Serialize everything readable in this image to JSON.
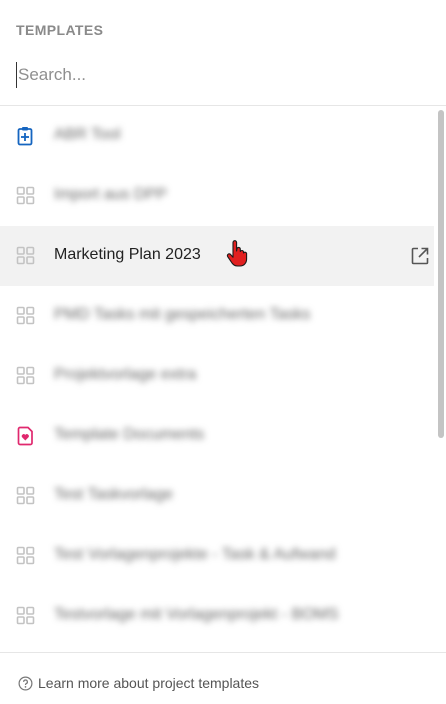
{
  "panel": {
    "section_title": "TEMPLATES",
    "search": {
      "placeholder": "Search...",
      "value": ""
    }
  },
  "templates": [
    {
      "label": "ABR Tool",
      "icon": "clipboard-plus-icon",
      "blurred": true
    },
    {
      "label": "Import aus DPP",
      "icon": "grid-icon",
      "blurred": true
    },
    {
      "label": "Marketing Plan 2023",
      "icon": "grid-icon",
      "blurred": false,
      "hovered": true
    },
    {
      "label": "PMD Tasks mit gespeicherten Tasks",
      "icon": "grid-icon",
      "blurred": true
    },
    {
      "label": "Projektvorlage extra",
      "icon": "grid-icon",
      "blurred": true
    },
    {
      "label": "Template Documents",
      "icon": "heart-document-icon",
      "blurred": true
    },
    {
      "label": "Test Taskvorlage",
      "icon": "grid-icon",
      "blurred": true
    },
    {
      "label": "Test Vorlagenprojekte - Task & Aufwand",
      "icon": "grid-icon",
      "blurred": true
    },
    {
      "label": "Testvorlage mit Vorlagenprojekt - BOMS",
      "icon": "grid-icon",
      "blurred": true
    }
  ],
  "footer": {
    "link_label": "Learn more about project templates",
    "icon": "help-circle-icon"
  },
  "colors": {
    "clipboard_icon": "#1565c0",
    "heart_icon": "#e0286e",
    "grid_icon": "#c3c3c3",
    "hover_row": "#f2f2f2",
    "cursor": "#e02020"
  }
}
